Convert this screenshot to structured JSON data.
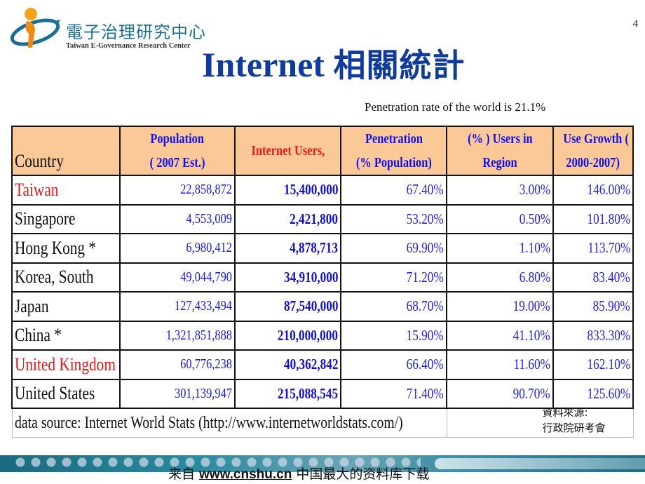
{
  "header": {
    "logo_name_zh": "電子治理研究中心",
    "logo_name_en": "Taiwan E-Governance Research Center",
    "page_number": "4"
  },
  "slide": {
    "title_en": "Internet",
    "title_zh": "相關統計",
    "subtitle": "Penetration rate of the world is 21.1%"
  },
  "table": {
    "headers": {
      "country": "Country",
      "population_line1": "Population",
      "population_line2": "( 2007 Est.)",
      "internet_users": "Internet Users,",
      "penetration_line1": "Penetration",
      "penetration_line2": "(%  Population)",
      "users_region_line1": "(% ) Users in",
      "users_region_line2": "Region",
      "growth_line1": "Use Growth (",
      "growth_line2": "2000-2007)"
    },
    "rows": [
      {
        "country": "Taiwan",
        "highlight": true,
        "population": "22,858,872",
        "internet_users": "15,400,000",
        "penetration": "67.40%",
        "users_in_region": "3.00%",
        "growth": "146.00%"
      },
      {
        "country": "Singapore",
        "highlight": false,
        "population": "4,553,009",
        "internet_users": "2,421,800",
        "penetration": "53.20%",
        "users_in_region": "0.50%",
        "growth": "101.80%"
      },
      {
        "country": "Hong Kong *",
        "highlight": false,
        "population": "6,980,412",
        "internet_users": "4,878,713",
        "penetration": "69.90%",
        "users_in_region": "1.10%",
        "growth": "113.70%"
      },
      {
        "country": "Korea, South",
        "highlight": false,
        "population": "49,044,790",
        "internet_users": "34,910,000",
        "penetration": "71.20%",
        "users_in_region": "6.80%",
        "growth": "83.40%"
      },
      {
        "country": "Japan",
        "highlight": false,
        "population": "127,433,494",
        "internet_users": "87,540,000",
        "penetration": "68.70%",
        "users_in_region": "19.00%",
        "growth": "85.90%"
      },
      {
        "country": "China *",
        "highlight": false,
        "population": "1,321,851,888",
        "internet_users": "210,000,000",
        "penetration": "15.90%",
        "users_in_region": "41.10%",
        "growth": "833.30%"
      },
      {
        "country": "United Kingdom",
        "highlight": true,
        "population": "60,776,238",
        "internet_users": "40,362,842",
        "penetration": "66.40%",
        "users_in_region": "11.60%",
        "growth": "162.10%"
      },
      {
        "country": "United States",
        "highlight": false,
        "population": "301,139,947",
        "internet_users": "215,088,545",
        "penetration": "71.40%",
        "users_in_region": "90.70%",
        "growth": "125.60%"
      }
    ],
    "data_source": "data source: Internet World Stats (http://www.internetworldstats.com/)",
    "source_note_line1": "資料來源:",
    "source_note_line2": "行政院研考會"
  },
  "footer": {
    "prefix": "来自",
    "link": "www.cnshu.cn",
    "suffix": "中国最大的资料库下载"
  },
  "colors": {
    "title_blue": "#0f3c9c",
    "header_bg": "#fbc898",
    "value_blue": "#1a1ae0",
    "highlight_red": "#e41818",
    "banner_teal": "#1a6a80"
  }
}
